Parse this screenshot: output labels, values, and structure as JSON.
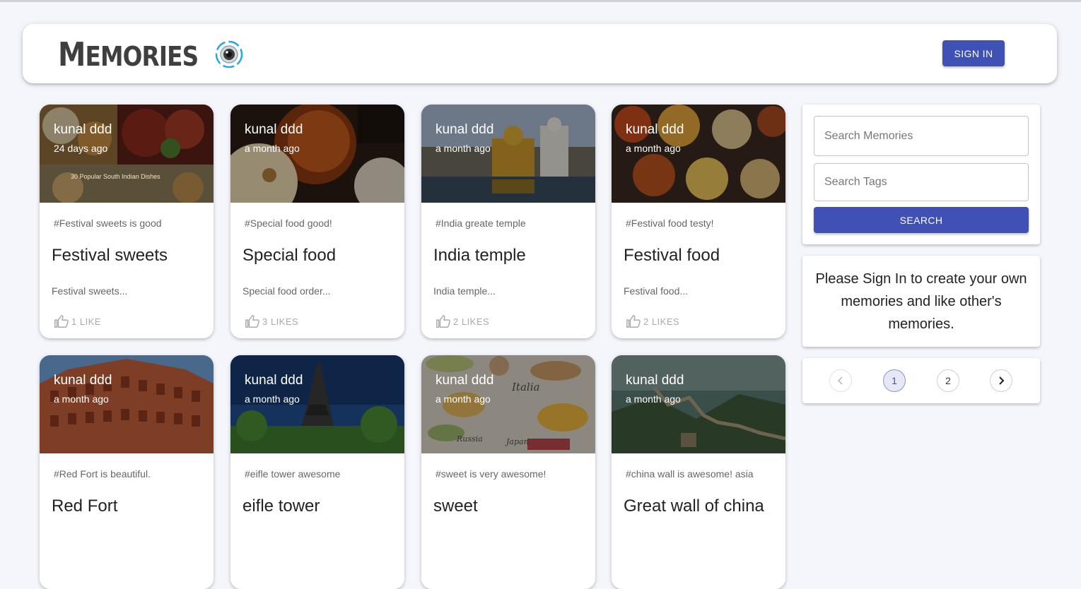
{
  "header": {
    "brand_first": "M",
    "brand_rest": "EMORIES",
    "logo_icon": "camera-lens-icon",
    "signin_label": "SIGN IN"
  },
  "posts": [
    {
      "creator": "kunal ddd",
      "time": "24 days ago",
      "tags": "#Festival sweets is good",
      "title": "Festival sweets",
      "message": "Festival sweets...",
      "likes": "1 LIKE",
      "image_caption": "30 Popular South Indian Dishes"
    },
    {
      "creator": "kunal ddd",
      "time": "a month ago",
      "tags": "#Special food good!",
      "title": "Special food",
      "message": "Special food order...",
      "likes": "3 LIKES"
    },
    {
      "creator": "kunal ddd",
      "time": "a month ago",
      "tags": "#India greate temple",
      "title": "India temple",
      "message": "India temple...",
      "likes": "2 LIKES"
    },
    {
      "creator": "kunal ddd",
      "time": "a month ago",
      "tags": "#Festival food testy!",
      "title": "Festival food",
      "message": "Festival food...",
      "likes": "2 LIKES"
    },
    {
      "creator": "kunal ddd",
      "time": "a month ago",
      "tags": "#Red Fort is beautiful.",
      "title": "Red Fort"
    },
    {
      "creator": "kunal ddd",
      "time": "a month ago",
      "tags": "#eifle tower awesome",
      "title": "eifle tower"
    },
    {
      "creator": "kunal ddd",
      "time": "a month ago",
      "tags": "#sweet is very awesome!",
      "title": "sweet",
      "image_words": [
        "Italia",
        "Russia",
        "Japan"
      ]
    },
    {
      "creator": "kunal ddd",
      "time": "a month ago",
      "tags": "#china wall is awesome! asia",
      "title": "Great wall of china"
    }
  ],
  "search": {
    "memories_placeholder": "Search Memories",
    "tags_placeholder": "Search Tags",
    "button_label": "SEARCH"
  },
  "info": {
    "text": "Please Sign In to create your own memories and like other's memories."
  },
  "pagination": {
    "pages": [
      "1",
      "2"
    ],
    "current": "1"
  },
  "colors": {
    "primary": "#3f51b5",
    "background": "#f4f6fb"
  }
}
